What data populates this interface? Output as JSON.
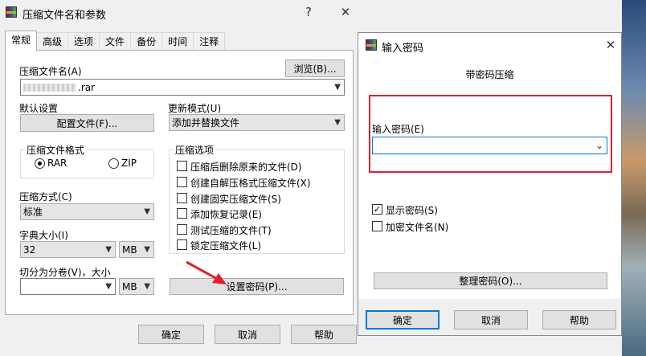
{
  "main_window": {
    "title": "压缩文件名和参数",
    "help_glyph": "?",
    "close_glyph": "✕",
    "tabs": [
      "常规",
      "高级",
      "选项",
      "文件",
      "备份",
      "时间",
      "注释"
    ],
    "archive_name_label": "压缩文件名(A)",
    "browse_button": "浏览(B)...",
    "archive_name_value": ".rar",
    "default_settings_label": "默认设置",
    "profiles_button": "配置文件(F)...",
    "update_mode_label": "更新模式(U)",
    "update_mode_value": "添加并替换文件",
    "format_group_title": "压缩文件格式",
    "format_rar": "RAR",
    "format_zip": "ZIP",
    "format_selected": "RAR",
    "options_group_title": "压缩选项",
    "options": [
      {
        "label": "压缩后删除原来的文件(D)",
        "checked": false
      },
      {
        "label": "创建自解压格式压缩文件(X)",
        "checked": false
      },
      {
        "label": "创建固实压缩文件(S)",
        "checked": false
      },
      {
        "label": "添加恢复记录(E)",
        "checked": false
      },
      {
        "label": "测试压缩的文件(T)",
        "checked": false
      },
      {
        "label": "锁定压缩文件(L)",
        "checked": false
      }
    ],
    "method_label": "压缩方式(C)",
    "method_value": "标准",
    "dict_label": "字典大小(I)",
    "dict_value": "32",
    "dict_unit": "MB",
    "split_label": "切分为分卷(V)，大小",
    "split_value": "",
    "split_unit": "MB",
    "set_password_button": "设置密码(P)...",
    "ok_button": "确定",
    "cancel_button": "取消",
    "help_button": "帮助"
  },
  "password_dialog": {
    "title": "输入密码",
    "close_glyph": "✕",
    "heading": "带密码压缩",
    "enter_password_label": "输入密码(E)",
    "password_value": "",
    "show_password_label": "显示密码(S)",
    "show_password_checked": true,
    "encrypt_names_label": "加密文件名(N)",
    "encrypt_names_checked": false,
    "organize_button": "整理密码(O)...",
    "ok_button": "确定",
    "cancel_button": "取消",
    "help_button": "帮助"
  },
  "colors": {
    "highlight_box": "#e0202a",
    "arrow": "#e0202a",
    "focus_border": "#0078d7"
  }
}
